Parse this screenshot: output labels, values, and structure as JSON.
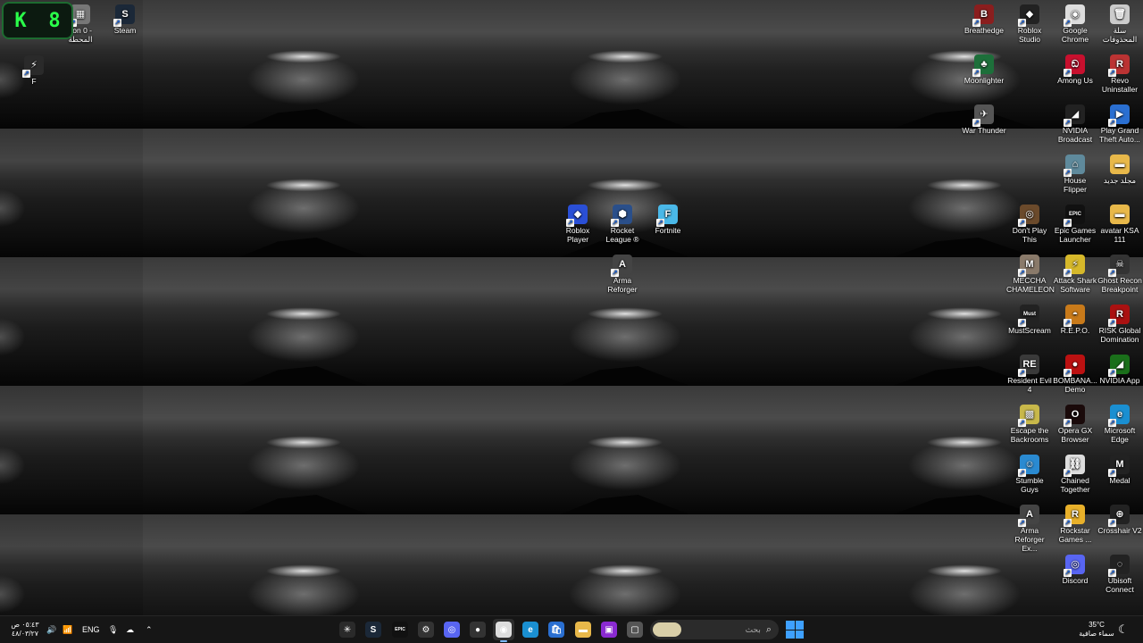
{
  "overlay": {
    "left_char": "K",
    "right_char": "8"
  },
  "desktop_icons": [
    {
      "id": "station",
      "label": "tion 0 -\nالمحطة",
      "color": "#777",
      "glyph": "▦"
    },
    {
      "id": "steam",
      "label": "Steam",
      "color": "#1b2838",
      "glyph": "S"
    },
    {
      "id": "f",
      "label": "F",
      "color": "#2a2a2a",
      "glyph": "⚡"
    },
    {
      "id": "breathedge",
      "label": "Breathedge",
      "color": "#8a1e1e",
      "glyph": "B"
    },
    {
      "id": "roblox-studio",
      "label": "Roblox\nStudio",
      "color": "#222",
      "glyph": "◆"
    },
    {
      "id": "chrome",
      "label": "Google\nChrome",
      "color": "#ddd",
      "glyph": "◉"
    },
    {
      "id": "recycle-bin",
      "label": "سلة\nالمحذوفات",
      "color": "#ccc",
      "glyph": "🗑"
    },
    {
      "id": "moonlighter",
      "label": "Moonlighter",
      "color": "#1d6f3a",
      "glyph": "♣"
    },
    {
      "id": "among-us",
      "label": "Among Us",
      "color": "#c8102e",
      "glyph": "ඞ"
    },
    {
      "id": "revo",
      "label": "Revo\nUninstaller",
      "color": "#b33",
      "glyph": "R"
    },
    {
      "id": "war-thunder",
      "label": "War Thunder",
      "color": "#555",
      "glyph": "✈"
    },
    {
      "id": "nvidia-broadcast",
      "label": "NVIDIA\nBroadcast",
      "color": "#222",
      "glyph": "◢"
    },
    {
      "id": "gta",
      "label": "Play Grand\nTheft Auto...",
      "color": "#2a6fd1",
      "glyph": "▶"
    },
    {
      "id": "house-flipper",
      "label": "House\nFlipper",
      "color": "#5f8a9c",
      "glyph": "⌂"
    },
    {
      "id": "new-folder",
      "label": "مجلد جديد",
      "color": "#e8b84a",
      "glyph": "▬"
    },
    {
      "id": "dont-play-this",
      "label": "Don't Play\nThis",
      "color": "#6b4a2b",
      "glyph": "◎"
    },
    {
      "id": "epic",
      "label": "Epic Games\nLauncher",
      "color": "#111",
      "glyph": "EPIC"
    },
    {
      "id": "avatar-ksa",
      "label": "avatar KSA\n111",
      "color": "#e8b84a",
      "glyph": "▬"
    },
    {
      "id": "roblox-player",
      "label": "Roblox Player",
      "color": "#2a4fd6",
      "glyph": "◆"
    },
    {
      "id": "rocket-league",
      "label": "Rocket\nLeague ®",
      "color": "#2a4f8a",
      "glyph": "⬢"
    },
    {
      "id": "fortnite",
      "label": "Fortnite",
      "color": "#4ab8e8",
      "glyph": "F"
    },
    {
      "id": "arma-reforger",
      "label": "Arma\nReforger",
      "color": "#444",
      "glyph": "A"
    },
    {
      "id": "meccha",
      "label": "MECCHA\nCHAMELEON",
      "color": "#8a7a6a",
      "glyph": "M"
    },
    {
      "id": "attack-shark",
      "label": "Attack Shark\nSoftware",
      "color": "#d6b82a",
      "glyph": "⚡"
    },
    {
      "id": "ghost-recon",
      "label": "Ghost Recon\nBreakpoint",
      "color": "#333",
      "glyph": "☠"
    },
    {
      "id": "mustscream",
      "label": "MustScream",
      "color": "#222",
      "glyph": "Must"
    },
    {
      "id": "repo",
      "label": "R.E.P.O.",
      "color": "#c87a1a",
      "glyph": "◓"
    },
    {
      "id": "risk",
      "label": "RISK Global\nDomination",
      "color": "#a11",
      "glyph": "R"
    },
    {
      "id": "resident-evil",
      "label": "Resident Evil\n4",
      "color": "#3a3a3a",
      "glyph": "RE"
    },
    {
      "id": "bombana",
      "label": "BOMBANA...\nDemo",
      "color": "#b11",
      "glyph": "●"
    },
    {
      "id": "nvidia-app",
      "label": "NVIDIA App",
      "color": "#1a6f1a",
      "glyph": "◢"
    },
    {
      "id": "escape-backrooms",
      "label": "Escape the\nBackrooms",
      "color": "#c8b84a",
      "glyph": "▩"
    },
    {
      "id": "opera-gx",
      "label": "Opera GX\nBrowser",
      "color": "#1a0a0a",
      "glyph": "O"
    },
    {
      "id": "edge",
      "label": "Microsoft\nEdge",
      "color": "#1a8fd1",
      "glyph": "e"
    },
    {
      "id": "stumble-guys",
      "label": "Stumble\nGuys",
      "color": "#2a8ad1",
      "glyph": "☺"
    },
    {
      "id": "chained-together",
      "label": "Chained\nTogether",
      "color": "#ddd",
      "glyph": "⛓"
    },
    {
      "id": "medal",
      "label": "Medal",
      "color": "#222",
      "glyph": "M"
    },
    {
      "id": "arma-reforger-ex",
      "label": "Arma\nReforger Ex...",
      "color": "#444",
      "glyph": "A"
    },
    {
      "id": "rockstar",
      "label": "Rockstar\nGames ...",
      "color": "#e8b02a",
      "glyph": "R"
    },
    {
      "id": "crosshair",
      "label": "Crosshair V2",
      "color": "#222",
      "glyph": "⊕"
    },
    {
      "id": "discord",
      "label": "Discord",
      "color": "#5865f2",
      "glyph": "◎"
    },
    {
      "id": "ubisoft",
      "label": "Ubisoft\nConnect",
      "color": "#222",
      "glyph": "◌"
    }
  ],
  "taskbar": {
    "apps": [
      {
        "id": "copilot",
        "glyph": "✳",
        "color": "#2a2a2a",
        "active": false
      },
      {
        "id": "steam",
        "glyph": "S",
        "color": "#1b2838",
        "active": false
      },
      {
        "id": "epic",
        "glyph": "EPIC",
        "color": "#111",
        "active": false
      },
      {
        "id": "steelseries",
        "glyph": "⚙",
        "color": "#333",
        "active": false
      },
      {
        "id": "discord",
        "glyph": "◎",
        "color": "#5865f2",
        "active": false
      },
      {
        "id": "obs",
        "glyph": "●",
        "color": "#333",
        "active": false
      },
      {
        "id": "chrome",
        "glyph": "◉",
        "color": "#ddd",
        "active": true
      },
      {
        "id": "edge",
        "glyph": "e",
        "color": "#1a8fd1",
        "active": false
      },
      {
        "id": "store",
        "glyph": "🛍",
        "color": "#2a6fd1",
        "active": false
      },
      {
        "id": "explorer",
        "glyph": "▬",
        "color": "#e8b84a",
        "active": false
      },
      {
        "id": "photos",
        "glyph": "▣",
        "color": "#8a2ad1",
        "active": false
      },
      {
        "id": "app-window",
        "glyph": "▢",
        "color": "#555",
        "active": false
      }
    ],
    "search_placeholder": "بحث",
    "start_icon": "start-icon",
    "weather": {
      "temp": "35°C",
      "desc": "سماء صافية"
    },
    "tray": {
      "language": "ENG",
      "time": "٠٥:٤٣ ص",
      "date": "٤٨/٠٣/٢٧"
    }
  }
}
